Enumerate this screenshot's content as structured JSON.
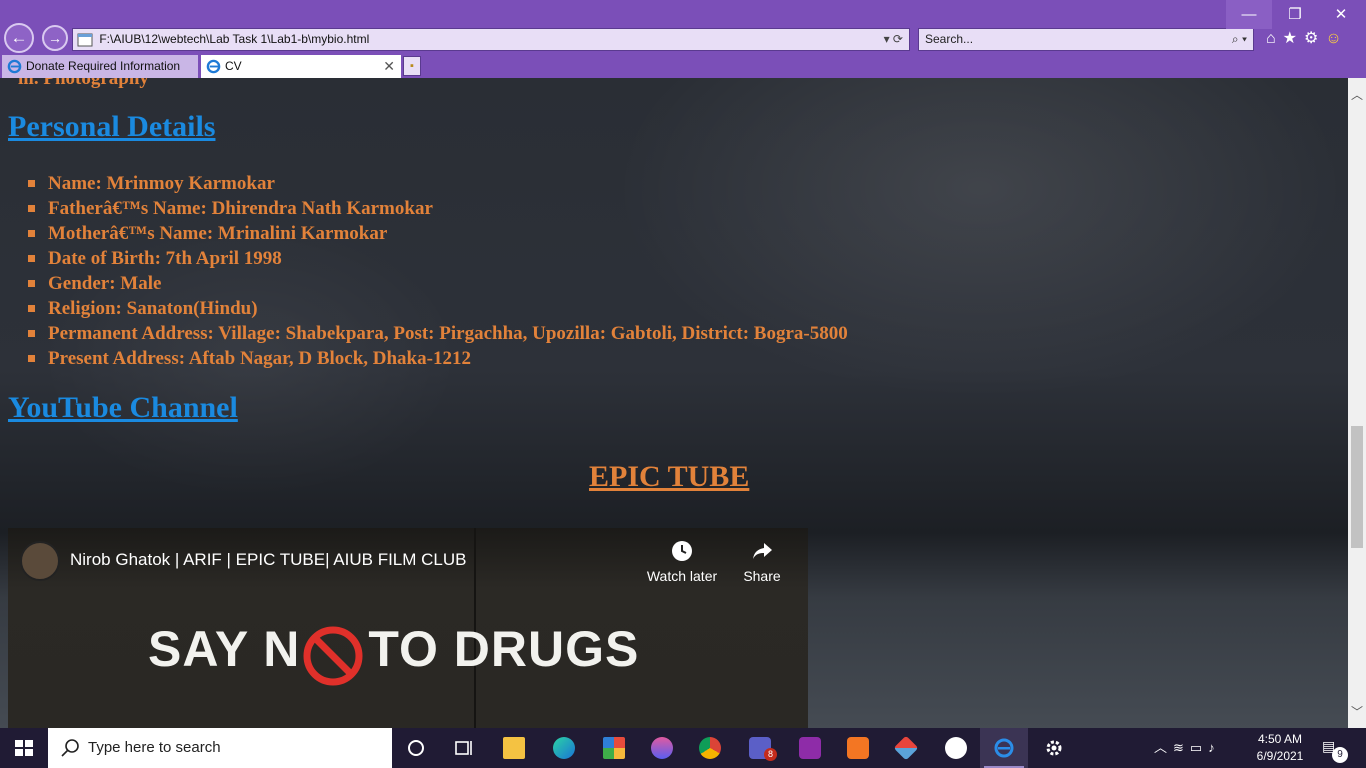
{
  "browser": {
    "address": "F:\\AIUB\\12\\webtech\\Lab Task 1\\Lab1-b\\mybio.html",
    "search_placeholder": "Search...",
    "tabs": [
      {
        "label": "Donate Required Information"
      },
      {
        "label": "CV"
      }
    ],
    "window_buttons": {
      "minimize": "—",
      "restore": "❐",
      "close": "✕"
    },
    "toolbar_icons": [
      "home-icon",
      "favorites-star-icon",
      "settings-gear-icon",
      "smiley-feedback-icon"
    ]
  },
  "page": {
    "hobby_last": "iii. Photography",
    "personal_heading": "Personal Details",
    "details": [
      "Name: Mrinmoy Karmokar",
      "Fatherâ€™s Name: Dhirendra Nath Karmokar",
      "Motherâ€™s Name: Mrinalini Karmokar",
      "Date of Birth: 7th April 1998",
      "Gender: Male",
      "Religion: Sanaton(Hindu)",
      "Permanent Address: Village: Shabekpara, Post: Pirgachha, Upozilla: Gabtoli, District: Bogra-5800",
      "Present Address: Aftab Nagar, D Block, Dhaka-1212"
    ],
    "youtube_heading": "YouTube Channel",
    "channel_name": "EPIC TUBE",
    "video": {
      "title": "Nirob Ghatok | ARIF | EPIC TUBE| AIUB FILM CLUB",
      "watch_later": "Watch later",
      "share": "Share",
      "frame_text_left": "SAY N",
      "frame_text_right": "TO DRUGS"
    },
    "colors": {
      "link_blue": "#1a8ae0",
      "text_orange": "#e2823a"
    }
  },
  "taskbar": {
    "search_placeholder": "Type here to search",
    "apps": [
      "task-view-icon",
      "file-explorer-icon",
      "edge-icon",
      "office-icon",
      "paint3d-icon",
      "chrome-icon",
      "teams-icon",
      "grammarly-pdf-icon",
      "xampp-icon",
      "git-icon",
      "github-icon",
      "internet-explorer-icon",
      "settings-icon"
    ],
    "teams_badge": "8",
    "time": "4:50 AM",
    "date": "6/9/2021",
    "notification_count": "9"
  }
}
